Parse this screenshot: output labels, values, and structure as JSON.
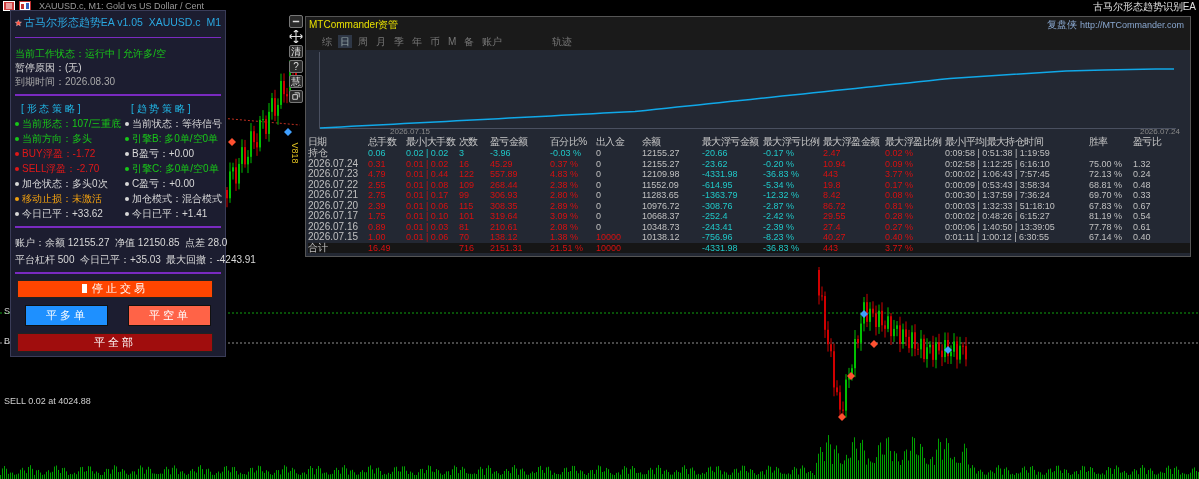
{
  "title_bar": {
    "chart_caption": "XAUUSD.c, M1: Gold vs US Dollar / Cent",
    "ea_name": "古马尔形态趋势识别EA"
  },
  "chart": {
    "labels": [
      {
        "kind": "sell_line",
        "text": "S"
      },
      {
        "kind": "buy_line",
        "text": "B"
      },
      {
        "kind": "order",
        "text": "SELL 0.02 at 4024.88"
      },
      {
        "kind": "vertical",
        "text": "V818"
      }
    ]
  },
  "side_tools": [
    {
      "kind": "minimize"
    },
    {
      "kind": "move"
    },
    {
      "kind": "text",
      "label": "清"
    },
    {
      "kind": "text",
      "label": "?"
    },
    {
      "kind": "text",
      "label": "慧"
    },
    {
      "kind": "restore"
    }
  ],
  "ea_panel": {
    "title": "古马尔形态趋势EA v1.05  XAUUSD.c  M1",
    "status_lines": [
      {
        "kind": "status",
        "text": "当前工作状态：运行中 | 允许多/空"
      },
      {
        "kind": "reason",
        "text": "暂停原因：(无)"
      },
      {
        "kind": "expiry",
        "text": "到期时间：2026.08.30"
      }
    ],
    "strategies": [
      {
        "heading": "[ 形 态 策 略 ]",
        "items": [
          {
            "text": "当前形态：107/三重底",
            "color": "#18c818"
          },
          {
            "text": "当前方向：多头",
            "color": "#18c818"
          },
          {
            "text": "BUY浮盈：-1.72",
            "color": "#e01818"
          },
          {
            "text": "SELL浮盈：-2.70",
            "color": "#e01818"
          },
          {
            "text": "加仓状态：多头0次",
            "color": "#d8d8d8"
          },
          {
            "text": "移动止损：未激活",
            "color": "#f0a010"
          },
          {
            "text": "今日已平：+33.62",
            "color": "#d8d8d8"
          }
        ]
      },
      {
        "heading": "[ 趋 势 策 略 ]",
        "items": [
          {
            "text": "当前状态：等待信号",
            "color": "#d8d8d8"
          },
          {
            "text": "引擎B: 多0单/空0单",
            "color": "#18c818"
          },
          {
            "text": "B盈亏：+0.00",
            "color": "#d8d8d8"
          },
          {
            "text": "引擎C: 多0单/空0单",
            "color": "#18c818"
          },
          {
            "text": "C盈亏：+0.00",
            "color": "#d8d8d8"
          },
          {
            "text": "加仓模式：混合模式",
            "color": "#d8d8d8"
          },
          {
            "text": "今日已平：+1.41",
            "color": "#d8d8d8"
          }
        ]
      }
    ],
    "account_lines": [
      "账户：余额 12155.27  净值 12150.85  点差 28.0",
      "平台杠杆 500  今日已平：+35.03  最大回撤：-4243.91"
    ],
    "buttons": [
      {
        "kind": "stop",
        "label": "停止交易"
      },
      {
        "kind": "close_buy",
        "label": "平多单"
      },
      {
        "kind": "close_sell",
        "label": "平空单"
      },
      {
        "kind": "close_all",
        "label": "平全部"
      }
    ]
  },
  "commander": {
    "title": "MTCommander资管",
    "brand": "复盘侠",
    "url": "http://MTCommander.com",
    "tabs": [
      {
        "label": "综",
        "selected": false
      },
      {
        "label": "日",
        "selected": true
      },
      {
        "label": "周",
        "selected": false
      },
      {
        "label": "月",
        "selected": false
      },
      {
        "label": "季",
        "selected": false
      },
      {
        "label": "年",
        "selected": false
      },
      {
        "label": "币",
        "selected": false
      },
      {
        "label": "M",
        "selected": false
      },
      {
        "label": "备",
        "selected": false
      },
      {
        "label": "账户",
        "selected": false
      },
      {
        "label": "轨迹",
        "selected": false
      }
    ],
    "equity_chart": {
      "start_label": "2026.07.15",
      "end_label": "2026.07.24"
    },
    "table": {
      "columns": [
        "日期",
        "总手数",
        "最小|大手数",
        "次数",
        "盈亏金额",
        "百分比%",
        "出入金",
        "余额",
        "最大浮亏金额",
        "最大浮亏比例",
        "最大浮盈金额",
        "最大浮盈比例",
        "最小|平均|最大持仓时间",
        "胜率",
        "盈亏比"
      ],
      "rows": [
        {
          "kind": "position",
          "cells": [
            "持仓",
            "0.06",
            "0.02 | 0.02",
            "3",
            "-3.96",
            "-0.03 %",
            "0",
            "12155.27",
            "-20.66",
            "-0.17 %",
            "2.47",
            "0.02 %",
            "0:09:58 | 0:51:38 | 1:19:59"
          ]
        },
        {
          "kind": "day",
          "cells": [
            "2026.07.24",
            "0.31",
            "0.01 | 0.02",
            "16",
            "45.29",
            "0.37 %",
            "0",
            "12155.27",
            "-23.62",
            "-0.20 %",
            "10.94",
            "0.09 %",
            "0:02:58 | 1:12:25 | 6:16:10",
            "75.00 %",
            "1.32"
          ]
        },
        {
          "kind": "day",
          "cells": [
            "2026.07.23",
            "4.79",
            "0.01 | 0.44",
            "122",
            "557.89",
            "4.83 %",
            "0",
            "12109.98",
            "-4331.98",
            "-36.83 %",
            "443",
            "3.77 %",
            "0:00:02 | 1:06:43 | 7:57:45",
            "72.13 %",
            "0.24"
          ]
        },
        {
          "kind": "day",
          "cells": [
            "2026.07.22",
            "2.55",
            "0.01 | 0.08",
            "109",
            "268.44",
            "2.38 %",
            "0",
            "11552.09",
            "-614.95",
            "-5.34 %",
            "19.8",
            "0.17 %",
            "0:00:09 | 0:53:43 | 3:58:34",
            "68.81 %",
            "0.48"
          ]
        },
        {
          "kind": "day",
          "cells": [
            "2026.07.21",
            "2.75",
            "0.01 | 0.17",
            "99",
            "306.93",
            "2.80 %",
            "0",
            "11283.65",
            "-1363.79",
            "-12.32 %",
            "8.42",
            "0.08 %",
            "0:00:30 | 1:37:59 | 7:36:24",
            "69.70 %",
            "0.33"
          ]
        },
        {
          "kind": "day",
          "cells": [
            "2026.07.20",
            "2.39",
            "0.01 | 0.06",
            "115",
            "308.35",
            "2.89 %",
            "0",
            "10976.72",
            "-308.76",
            "-2.87 %",
            "86.72",
            "0.81 %",
            "0:00:03 | 1:32:33 | 51:18:10",
            "67.83 %",
            "0.67"
          ]
        },
        {
          "kind": "day",
          "cells": [
            "2026.07.17",
            "1.75",
            "0.01 | 0.10",
            "101",
            "319.64",
            "3.09 %",
            "0",
            "10668.37",
            "-252.4",
            "-2.42 %",
            "29.55",
            "0.28 %",
            "0:00:02 | 0:48:26 | 6:15:27",
            "81.19 %",
            "0.54"
          ]
        },
        {
          "kind": "day",
          "cells": [
            "2026.07.16",
            "0.89",
            "0.01 | 0.03",
            "81",
            "210.61",
            "2.08 %",
            "0",
            "10348.73",
            "-243.41",
            "-2.39 %",
            "27.4",
            "0.27 %",
            "0:00:06 | 1:40:50 | 13:39:05",
            "77.78 %",
            "0.61"
          ]
        },
        {
          "kind": "deposit",
          "cells": [
            "2026.07.15",
            "1.00",
            "0.01 | 0.06",
            "70",
            "138.12",
            "1.38 %",
            "10000",
            "10138.12",
            "-756.96",
            "-8.23 %",
            "40.27",
            "0.40 %",
            "0:01:11 | 1:00:12 | 6:30:55",
            "67.14 %",
            "0.40"
          ]
        },
        {
          "kind": "total",
          "cells": [
            "合计",
            "16.49",
            null,
            "716",
            "2151.31",
            "21.51 %",
            "10000",
            null,
            "-4331.98",
            "-36.83 %",
            "443",
            "3.77 %"
          ]
        }
      ]
    }
  }
}
